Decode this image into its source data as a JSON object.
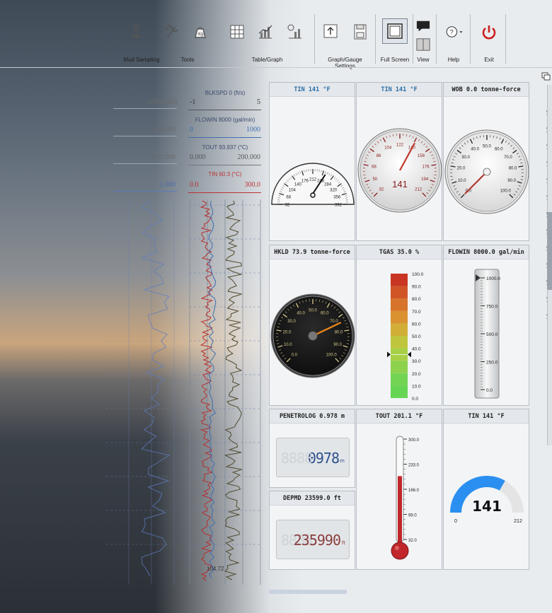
{
  "ribbon": {
    "groups": [
      {
        "label": "Mud Sampling"
      },
      {
        "label": "Tools"
      },
      {
        "label": "Table/Graph"
      },
      {
        "label": "Graph/Gauge Settings"
      },
      {
        "label": "Full Screen"
      },
      {
        "label": "View"
      },
      {
        "label": "Help"
      },
      {
        "label": "Exit"
      }
    ]
  },
  "tracks": {
    "left": [
      {
        "header": "",
        "min": "",
        "max": "10000.000"
      },
      {
        "header": "",
        "min": "",
        "max": "100.000"
      },
      {
        "header": "",
        "min": "",
        "max": "100.000"
      },
      {
        "header": "",
        "min": "",
        "max": "1.000"
      }
    ],
    "right": [
      {
        "header": "BLKSPD 0 (ft/s)",
        "min": "-1",
        "max": "5"
      },
      {
        "header": "FLOWIN 8000 (gal/min)",
        "min": "0",
        "max": "1000"
      },
      {
        "header": "TOUT 93.937 (°C)",
        "min": "0.000",
        "max": "200.000"
      },
      {
        "header": "TIN 60.3 (°C)",
        "min": "0.0",
        "max": "300.0"
      }
    ],
    "depth_bottom": "104.72"
  },
  "gauges": {
    "g1": {
      "title": "TIN 141 °F",
      "ticks": [
        "32",
        "68",
        "104",
        "140",
        "176",
        "212",
        "248",
        "284",
        "320",
        "356",
        "392"
      ],
      "value": 141
    },
    "g2": {
      "title": "TIN 141 °F",
      "ticks": [
        "32",
        "50",
        "68",
        "86",
        "104",
        "122",
        "140",
        "158",
        "176",
        "194",
        "212"
      ],
      "value": 141,
      "readout": "141"
    },
    "g3": {
      "title": "WOB 0.0 tonne-force",
      "ticks": [
        "0.0",
        "10.0",
        "20.0",
        "30.0",
        "40.0",
        "50.0",
        "60.0",
        "70.0",
        "80.0",
        "90.0",
        "100.0"
      ],
      "value": 0
    },
    "g4": {
      "title": "HKLD 73.9 tonne-force",
      "ticks": [
        "0.0",
        "10.0",
        "20.0",
        "30.0",
        "40.0",
        "50.0",
        "60.0",
        "70.0",
        "80.0",
        "90.0",
        "100.0"
      ],
      "value": 73.9
    },
    "g5": {
      "title": "TGAS 35.0 %",
      "ticks": [
        "100.0",
        "90.0",
        "80.0",
        "70.0",
        "60.0",
        "50.0",
        "40.0",
        "30.0",
        "20.0",
        "10.0",
        "0.0"
      ],
      "value": 35
    },
    "g6": {
      "title": "FLOWIN 8000.0 gal/min",
      "ticks": [
        "1000.0",
        "750.0",
        "500.0",
        "250.0",
        "0.0"
      ],
      "value": 1000
    },
    "g7": {
      "title": "PENETROLOG 0.978 m",
      "digits": "0978",
      "unit": "m"
    },
    "g8": {
      "title": "DEPMD 23599.0 ft",
      "digits": "235990",
      "unit": "ft"
    },
    "g9": {
      "title": "TOUT 201.1 °F",
      "ticks": [
        "300.0",
        "233.0",
        "166.0",
        "99.0",
        "32.0"
      ],
      "value": 201.1
    },
    "g10": {
      "title": "TIN 141 °F",
      "readout": "141",
      "min": "0",
      "max": "212",
      "value": 141
    }
  },
  "colors": {
    "accent_blue": "#2a8ff0",
    "needle_red": "#c0392b",
    "exit_red": "#cc1f1f",
    "hkld_needle": "#f08a1a"
  },
  "right_strip": {
    "items": [
      "y",
      "y",
      "y",
      "y",
      "y",
      "y",
      "y",
      "y",
      "y",
      "y",
      "y",
      "y",
      "y"
    ]
  }
}
